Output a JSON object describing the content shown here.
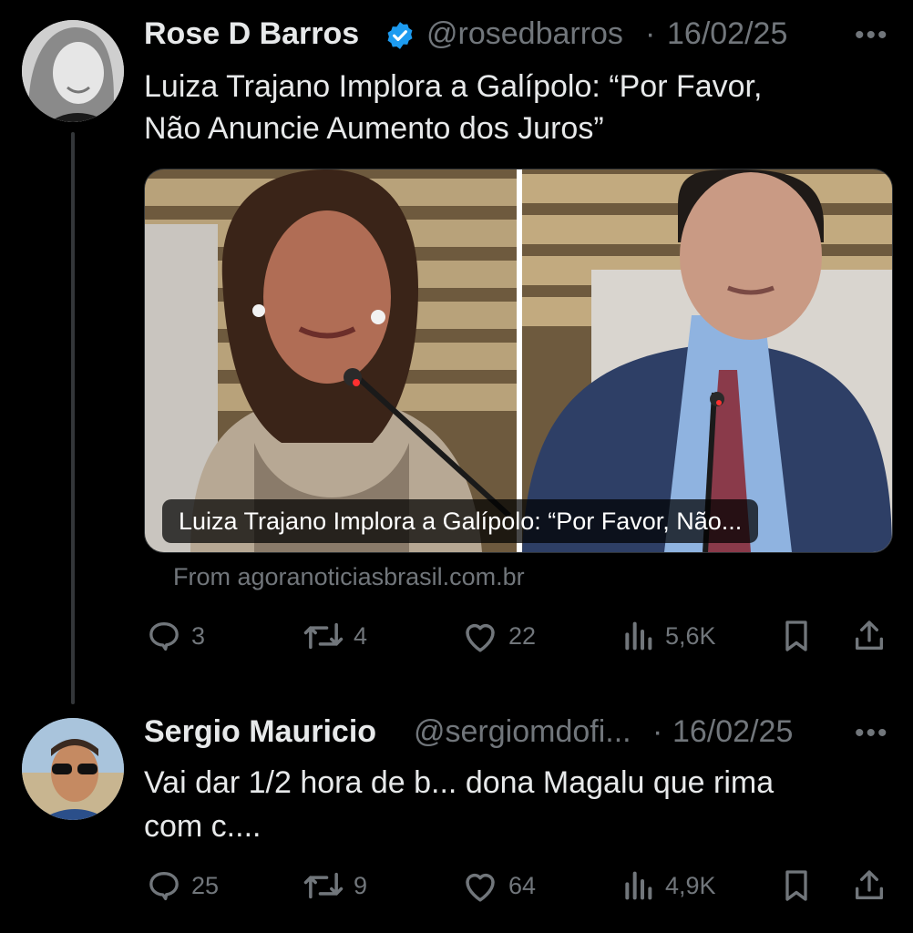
{
  "tweet": {
    "author_name": "Rose D Barros",
    "verified_icon": "verified-badge-icon",
    "handle": "@rosedbarros",
    "separator": "·",
    "date": "16/02/25",
    "more_label": "•••",
    "text_line1": "Luiza Trajano Implora a Galípolo: “Por Favor,",
    "text_line2": "Não Anuncie Aumento dos Juros”",
    "card_caption": "Luiza Trajano Implora a Galípolo: “Por Favor, Não...",
    "card_source": "From agoranoticiasbrasil.com.br",
    "replies": "3",
    "reposts": "4",
    "likes": "22",
    "views": "5,6K",
    "colors": {
      "verified": "#1d9bf0",
      "muted": "#71767b",
      "text": "#e7e9ea"
    }
  },
  "reply": {
    "author_name": "Sergio Mauricio",
    "handle": "@sergiomdofi...",
    "separator": "·",
    "date": "16/02/25",
    "more_label": "•••",
    "text_line1": "Vai dar 1/2 hora de b... dona Magalu que rima",
    "text_line2": "com c....",
    "replies": "25",
    "reposts": "9",
    "likes": "64",
    "views": "4,9K"
  }
}
